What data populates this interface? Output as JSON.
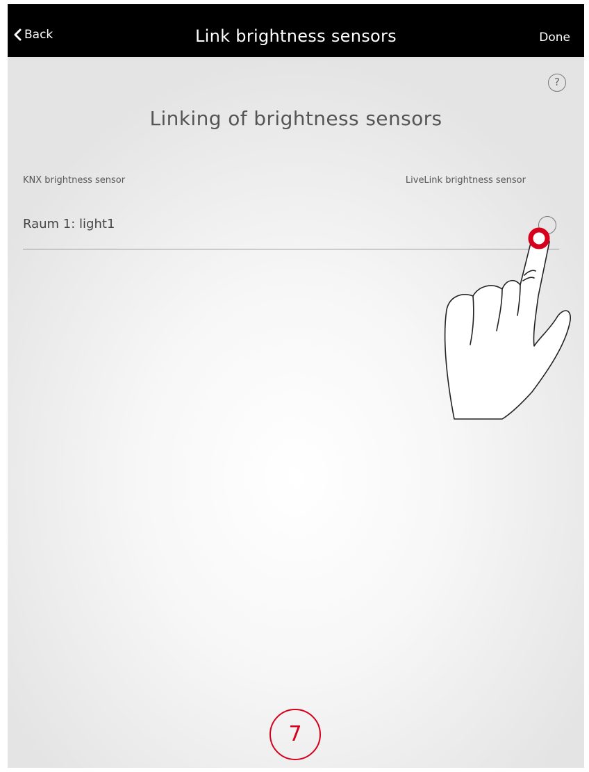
{
  "navbar": {
    "back_label": "Back",
    "title": "Link brightness sensors",
    "done_label": "Done"
  },
  "help": {
    "icon": "help-icon",
    "symbol": "?"
  },
  "main": {
    "heading": "Linking of brightness sensors",
    "columns": {
      "left": "KNX brightness sensor",
      "right": "LiveLink brightness sensor"
    },
    "rows": [
      {
        "label": "Raum 1: light1",
        "action_icon": "circle-button-icon"
      }
    ]
  },
  "annotation": {
    "step_number": "7",
    "tap_marker_icon": "tap-marker-icon",
    "hand_icon": "pointing-hand-icon"
  },
  "colors": {
    "navbar": "#000000",
    "accent": "#d5001c",
    "text": "#555555"
  }
}
